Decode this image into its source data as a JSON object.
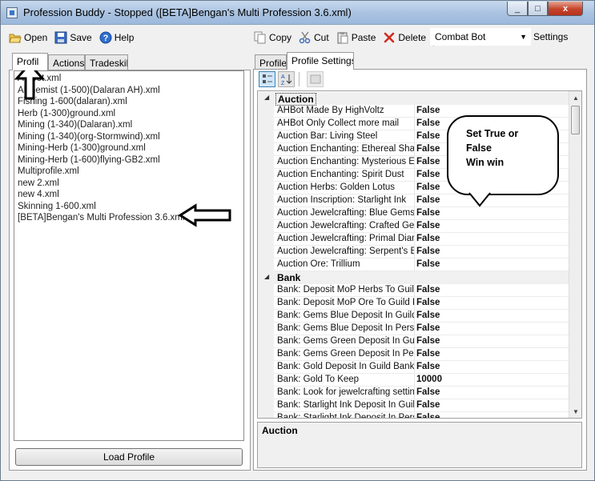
{
  "window": {
    "title": "Profession Buddy - Stopped ([BETA]Bengan's Multi Profession 3.6.xml)",
    "close_glyph": "x",
    "min_glyph": "_",
    "max_glyph": "□"
  },
  "toolbar_left": {
    "open": "Open",
    "save": "Save",
    "help": "Help"
  },
  "toolbar_right": {
    "copy": "Copy",
    "cut": "Cut",
    "paste": "Paste",
    "delete": "Delete",
    "bot_select": "Combat Bot",
    "settings": "Settings"
  },
  "left_tabs": [
    "Profile",
    "Actions",
    "Tradeskill"
  ],
  "left_tab_clipped": "Profil",
  "files": [
    "AHBot.xml",
    "Alchemist (1-500)(Dalaran AH).xml",
    "Fishing 1-600(dalaran).xml",
    "Herb (1-300)ground.xml",
    "Mining (1-340)(Dalaran).xml",
    "Mining (1-340)(org-Stormwind).xml",
    "Mining-Herb (1-300)ground.xml",
    "Mining-Herb (1-600)flying-GB2.xml",
    "Multiprofile.xml",
    "new  2.xml",
    "new  4.xml",
    "Skinning 1-600.xml",
    "[BETA]Bengan's Multi Profession 3.6.xml"
  ],
  "load_button": "Load Profile",
  "right_tabs": [
    "Profile",
    "Profile Settings"
  ],
  "property_grid": {
    "categories": [
      {
        "name": "Auction",
        "rows": [
          {
            "name": "AHBot Made By HighVoltz",
            "value": "False"
          },
          {
            "name": "AHBot Only Collect more mail",
            "value": "False"
          },
          {
            "name": "Auction Bar: Living Steel",
            "value": "False"
          },
          {
            "name": "Auction Enchanting: Ethereal Shard",
            "value": "False"
          },
          {
            "name": "Auction Enchanting: Mysterious Ess",
            "value": "False"
          },
          {
            "name": "Auction Enchanting: Spirit Dust",
            "value": "False"
          },
          {
            "name": "Auction Herbs: Golden Lotus",
            "value": "False"
          },
          {
            "name": "Auction Inscription: Starlight Ink",
            "value": "False"
          },
          {
            "name": "Auction Jewelcrafting: Blue Gems",
            "value": "False"
          },
          {
            "name": "Auction Jewelcrafting: Crafted Gems",
            "value": "False"
          },
          {
            "name": "Auction Jewelcrafting: Primal Diamo",
            "value": "False"
          },
          {
            "name": "Auction Jewelcrafting: Serpent's Eye",
            "value": "False"
          },
          {
            "name": "Auction Ore: Trillium",
            "value": "False"
          }
        ]
      },
      {
        "name": "Bank",
        "rows": [
          {
            "name": "Bank: Deposit MoP Herbs To Guild",
            "value": "False"
          },
          {
            "name": "Bank: Deposit MoP Ore To Guild Ba",
            "value": "False"
          },
          {
            "name": "Bank: Gems Blue Deposit In Guild B",
            "value": "False"
          },
          {
            "name": "Bank: Gems Blue Deposit In Person",
            "value": "False"
          },
          {
            "name": "Bank: Gems Green Deposit In Guild",
            "value": "False"
          },
          {
            "name": "Bank: Gems Green Deposit In Perso",
            "value": "False"
          },
          {
            "name": "Bank: Gold Deposit In Guild Bank",
            "value": "False"
          },
          {
            "name": "Bank: Gold To Keep",
            "value": "10000"
          },
          {
            "name": "Bank: Look for jewelcrafting setting.",
            "value": "False"
          },
          {
            "name": "Bank: Starlight Ink Deposit In Guild",
            "value": "False"
          },
          {
            "name": "Bank: Starlight Ink Deposit In Perso",
            "value": "False"
          }
        ]
      }
    ],
    "description_title": "Auction"
  },
  "annotation": {
    "bubble_lines": [
      "Set True or",
      "False",
      "Win win"
    ]
  }
}
